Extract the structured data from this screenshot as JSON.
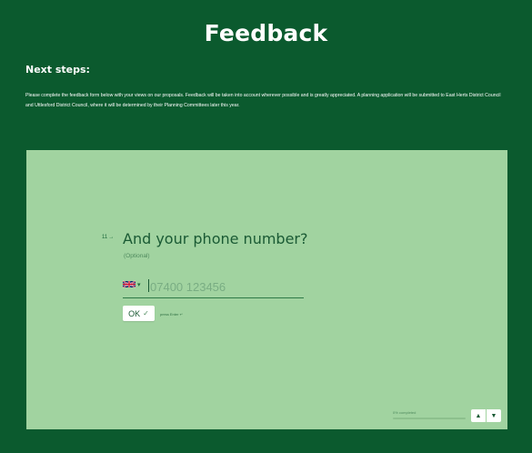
{
  "header": {
    "title": "Feedback"
  },
  "intro": {
    "heading": "Next steps:",
    "body": "Please complete the feedback form below with your views on our proposals. Feedback will be taken into account wherever possible and is greatly appreciated. A planning application will be submitted to East Herts District Council and Uttlesford District Council, where it will be determined by their Planning Committees later this year."
  },
  "form": {
    "question_number": "11",
    "question_arrow": "→",
    "question_text": "And your phone number?",
    "optional_label": "(Optional)",
    "country_flag": "uk-flag-icon",
    "country_chevron": "▾",
    "phone_placeholder": "07400 123456",
    "phone_value": "",
    "ok_label": "OK",
    "ok_check": "✓",
    "enter_hint": "press Enter ↵",
    "progress_label": "0% completed",
    "progress_fraction": 0,
    "nav_up": "▲",
    "nav_down": "▼"
  },
  "colors": {
    "page_background": "#0b5a2e",
    "panel_background": "#a1d3a0",
    "text_dark_green": "#1a5a34",
    "button_background": "#ffffff"
  }
}
